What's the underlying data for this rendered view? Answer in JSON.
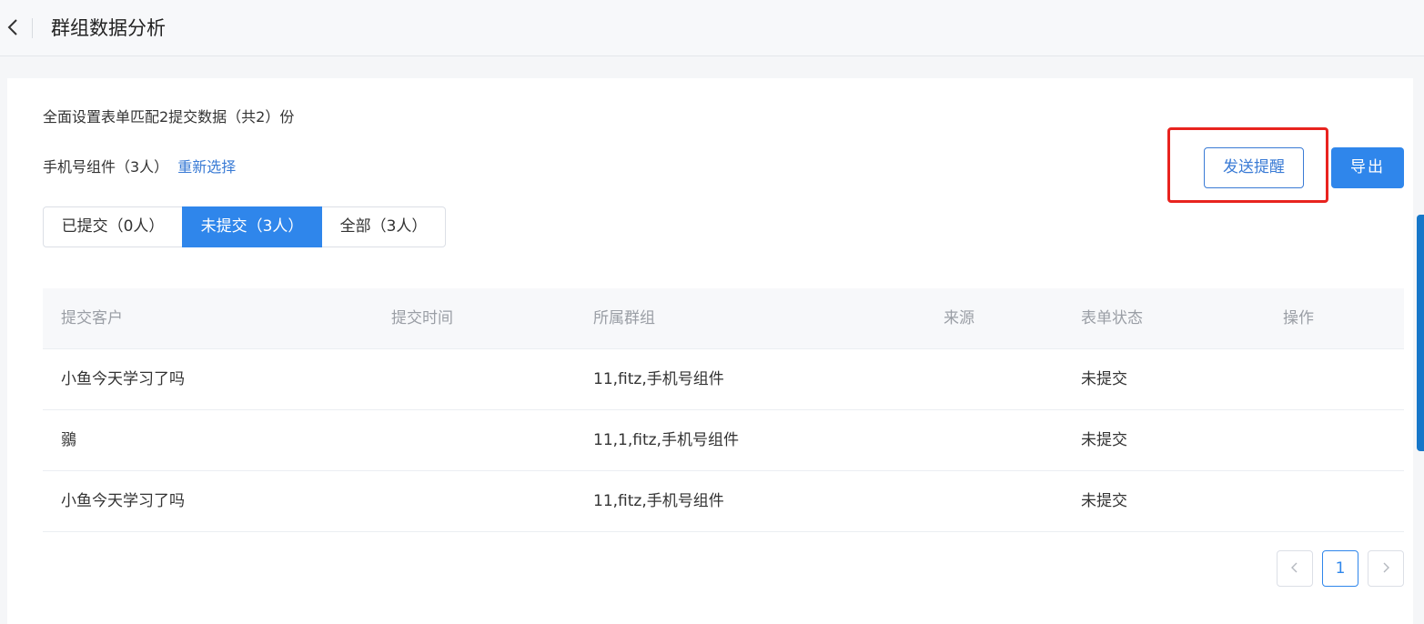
{
  "header": {
    "title": "群组数据分析",
    "back_icon": "chevron-left-icon"
  },
  "summary": {
    "text": "全面设置表单匹配2提交数据（共2）份"
  },
  "component": {
    "label": "手机号组件（3人）",
    "reselect_label": "重新选择"
  },
  "toolbar": {
    "remind_label": "发送提醒",
    "export_label": "导出",
    "highlight_color": "#e8231f",
    "accent_color": "#2f86eb"
  },
  "tabs": [
    {
      "label": "已提交（0人）",
      "active": false
    },
    {
      "label": "未提交（3人）",
      "active": true
    },
    {
      "label": "全部（3人）",
      "active": false
    }
  ],
  "table": {
    "columns": [
      "提交客户",
      "提交时间",
      "所属群组",
      "来源",
      "表单状态",
      "操作"
    ],
    "rows": [
      {
        "customer": "小鱼今天学习了吗",
        "time": "",
        "group": "11,fitz,手机号组件",
        "source": "",
        "status": "未提交",
        "action": ""
      },
      {
        "customer": "鶸",
        "time": "",
        "group": "11,1,fitz,手机号组件",
        "source": "",
        "status": "未提交",
        "action": ""
      },
      {
        "customer": "小鱼今天学习了吗",
        "time": "",
        "group": "11,fitz,手机号组件",
        "source": "",
        "status": "未提交",
        "action": ""
      }
    ]
  },
  "pagination": {
    "current_page": "1",
    "prev_icon": "chevron-left-icon",
    "next_icon": "chevron-right-icon"
  }
}
